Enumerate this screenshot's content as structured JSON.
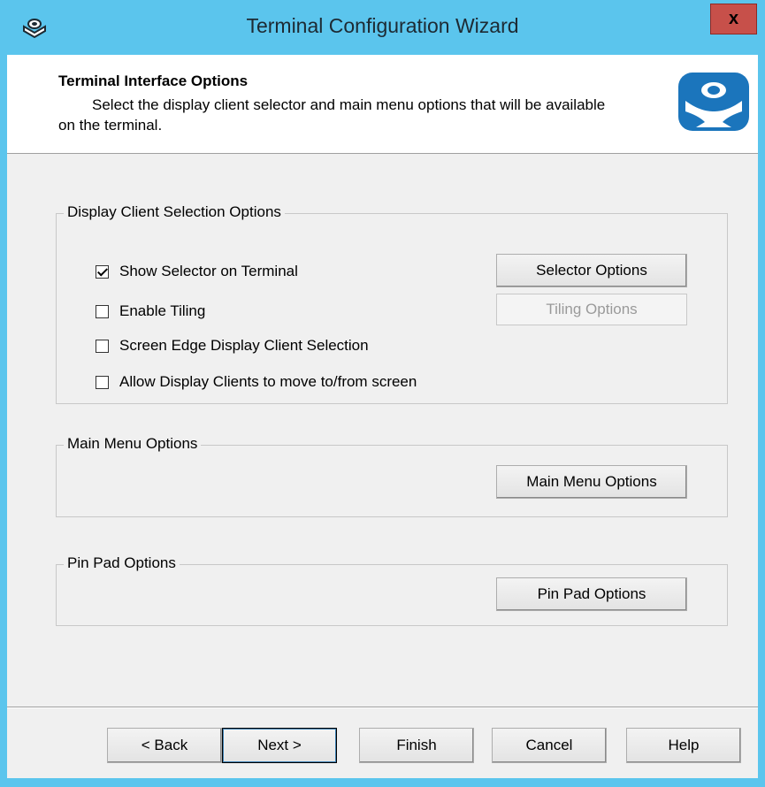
{
  "window": {
    "title": "Terminal Configuration Wizard",
    "close_label": "x",
    "accent_color": "#5bc5ed",
    "close_color": "#c7504a"
  },
  "header": {
    "title": "Terminal Interface Options",
    "description_line1": "Select the display client selector and main menu options that will be available",
    "description_line2": "on the terminal.",
    "logo_icon": "thinmanager-logo-icon"
  },
  "display_client_group": {
    "label": "Display Client Selection Options",
    "checkboxes": [
      {
        "label": "Show Selector on Terminal",
        "checked": true
      },
      {
        "label": "Enable Tiling",
        "checked": false
      },
      {
        "label": "Screen Edge Display Client Selection",
        "checked": false
      },
      {
        "label": "Allow Display Clients to move to/from screen",
        "checked": false
      }
    ],
    "selector_options_label": "Selector Options",
    "tiling_options_label": "Tiling Options"
  },
  "main_menu_group": {
    "label": "Main Menu Options",
    "button_label": "Main Menu Options"
  },
  "pin_pad_group": {
    "label": "Pin Pad Options",
    "button_label": "Pin Pad Options"
  },
  "footer": {
    "back_label": "< Back",
    "next_label": "Next >",
    "finish_label": "Finish",
    "cancel_label": "Cancel",
    "help_label": "Help"
  }
}
